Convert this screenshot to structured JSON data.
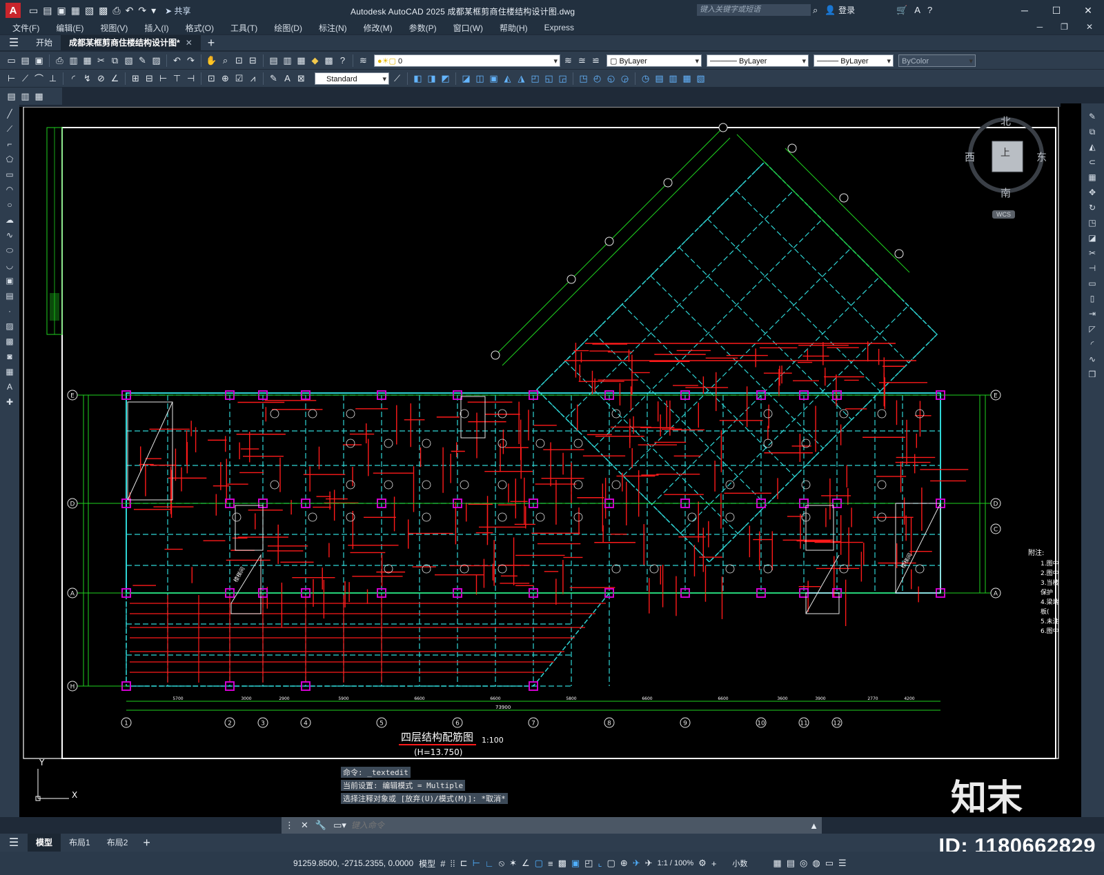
{
  "titlebar": {
    "app_letter": "A",
    "share_label": "共享",
    "title": "Autodesk AutoCAD 2025    成都某框剪商住楼结构设计图.dwg",
    "search_placeholder": "键入关键字或短语",
    "login_label": "登录"
  },
  "menu": [
    "文件(F)",
    "编辑(E)",
    "视图(V)",
    "插入(I)",
    "格式(O)",
    "工具(T)",
    "绘图(D)",
    "标注(N)",
    "修改(M)",
    "参数(P)",
    "窗口(W)",
    "帮助(H)",
    "Express"
  ],
  "filetabs": {
    "start": "开始",
    "active": "成都某框剪商住楼结构设计图*"
  },
  "layers": {
    "current_layer": "0",
    "color": "ByLayer",
    "linetype": "ByLayer",
    "lineweight": "ByLayer",
    "plotstyle": "ByColor",
    "text_style": "Standard"
  },
  "viewcube": {
    "north": "北",
    "south": "南",
    "west": "西",
    "east": "东",
    "face": "上",
    "wcs": "WCS"
  },
  "drawing": {
    "title": "四层结构配筋图",
    "scale": "1:100",
    "elevation": "(H=13.750)",
    "notes_title": "附注:",
    "notes": [
      "1.图中",
      "2.图中",
      "3.当楼",
      "保护",
      "4.梁端",
      "板(",
      "5.未注",
      "6.图中"
    ],
    "axis_bottom": [
      "1",
      "2",
      "3",
      "4",
      "5",
      "6",
      "7",
      "8",
      "9",
      "10",
      "11",
      "12"
    ],
    "axis_left": [
      "E",
      "D",
      "A",
      "H"
    ],
    "axis_right": [
      "E",
      "D",
      "C",
      "A"
    ],
    "total_dim": "73900",
    "dims_bottom": [
      "5700",
      "3000",
      "2900",
      "5900",
      "6600",
      "6600",
      "5800",
      "6600",
      "6600",
      "3600",
      "3900",
      "2770",
      "4200"
    ],
    "stair_label": "楼梯间",
    "ucs_y": "Y",
    "ucs_x": "X"
  },
  "command": {
    "history": [
      "命令: _textedit",
      "当前设置: 编辑模式 = Multiple",
      "选择注释对象或 [放弃(U)/模式(M)]: *取消*"
    ],
    "placeholder": "键入命令"
  },
  "layouts": [
    "模型",
    "布局1",
    "布局2"
  ],
  "status": {
    "coords": "91259.8500, -2715.2355, 0.0000",
    "model_label": "模型",
    "annot_scale": "1:1 / 100%",
    "units": "小数"
  },
  "watermark": {
    "brand": "知末",
    "id": "ID: 1180662829"
  },
  "colors": {
    "beam_red": "#ff1a1a",
    "grid_green": "#1fd41f",
    "slab_cyan": "#2fd6d6",
    "column_magenta": "#d000d0",
    "canvas_bg": "#000000",
    "ui_dark": "#22303f"
  }
}
